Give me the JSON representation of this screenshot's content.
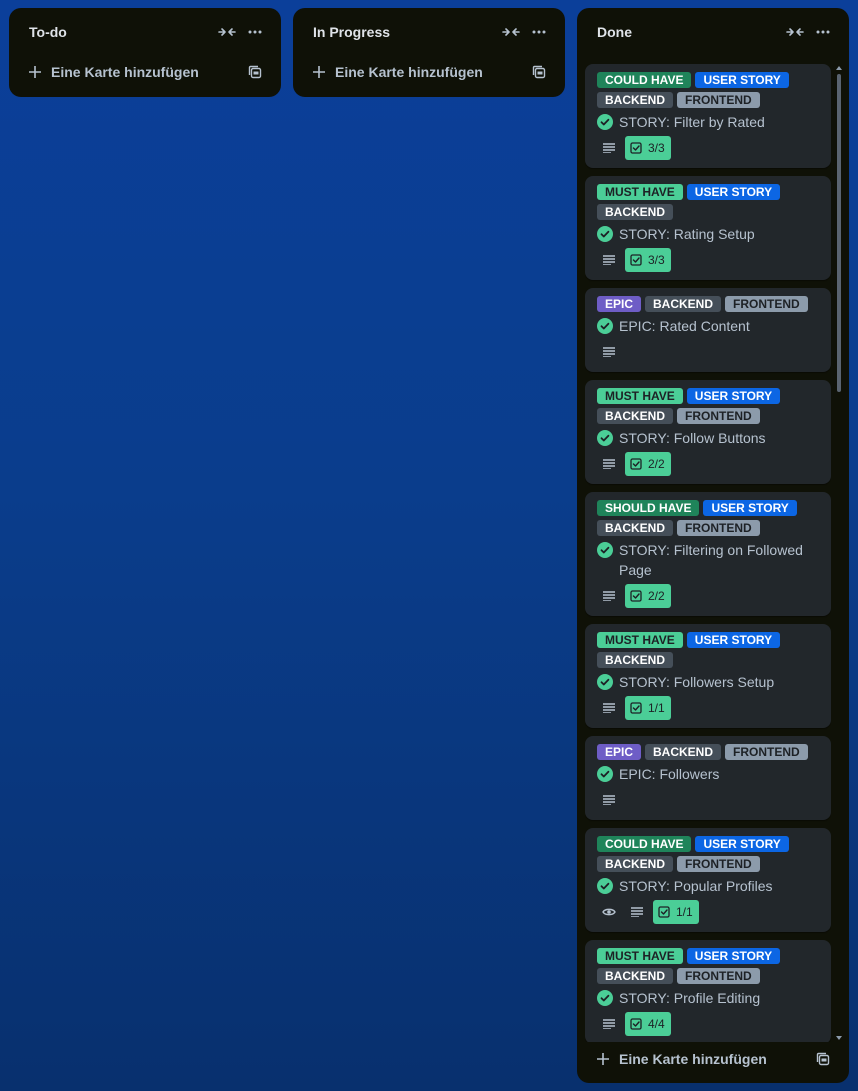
{
  "lists": [
    {
      "title": "To-do",
      "add_label": "Eine Karte hinzufügen"
    },
    {
      "title": "In Progress",
      "add_label": "Eine Karte hinzufügen"
    },
    {
      "title": "Done",
      "add_label": "Eine Karte hinzufügen",
      "cards": [
        {
          "labels": [
            "COULD HAVE",
            "USER STORY",
            "BACKEND",
            "FRONTEND"
          ],
          "title": "STORY: Filter by Rated",
          "checklist": "3/3",
          "watching": false
        },
        {
          "labels": [
            "MUST HAVE",
            "USER STORY",
            "BACKEND"
          ],
          "title": "STORY: Rating Setup",
          "checklist": "3/3",
          "watching": false
        },
        {
          "labels": [
            "EPIC",
            "BACKEND",
            "FRONTEND"
          ],
          "title": "EPIC: Rated Content",
          "checklist": "",
          "watching": false
        },
        {
          "labels": [
            "MUST HAVE",
            "USER STORY",
            "BACKEND",
            "FRONTEND"
          ],
          "title": "STORY: Follow Buttons",
          "checklist": "2/2",
          "watching": false
        },
        {
          "labels": [
            "SHOULD HAVE",
            "USER STORY",
            "BACKEND",
            "FRONTEND"
          ],
          "title": "STORY: Filtering on Followed Page",
          "checklist": "2/2",
          "watching": false
        },
        {
          "labels": [
            "MUST HAVE",
            "USER STORY",
            "BACKEND"
          ],
          "title": "STORY: Followers Setup",
          "checklist": "1/1",
          "watching": false
        },
        {
          "labels": [
            "EPIC",
            "BACKEND",
            "FRONTEND"
          ],
          "title": "EPIC: Followers",
          "checklist": "",
          "watching": false
        },
        {
          "labels": [
            "COULD HAVE",
            "USER STORY",
            "BACKEND",
            "FRONTEND"
          ],
          "title": "STORY: Popular Profiles",
          "checklist": "1/1",
          "watching": true
        },
        {
          "labels": [
            "MUST HAVE",
            "USER STORY",
            "BACKEND",
            "FRONTEND"
          ],
          "title": "STORY: Profile Editing",
          "checklist": "4/4",
          "watching": false
        }
      ]
    }
  ],
  "label_colors": {
    "COULD HAVE": "#1f845a",
    "MUST HAVE": "#4bce97",
    "SHOULD HAVE": "#1f845a",
    "USER STORY": "#0c66e4",
    "BACKEND": "#454f59",
    "FRONTEND": "#8c9bab",
    "EPIC": "#6e5dc6"
  },
  "icons": {
    "collapse": "collapse-icon",
    "more": "more-icon",
    "add": "plus-icon",
    "template": "template-icon",
    "complete": "check-circle-icon",
    "description": "description-icon",
    "checklist": "checklist-icon",
    "watch": "eye-icon"
  }
}
